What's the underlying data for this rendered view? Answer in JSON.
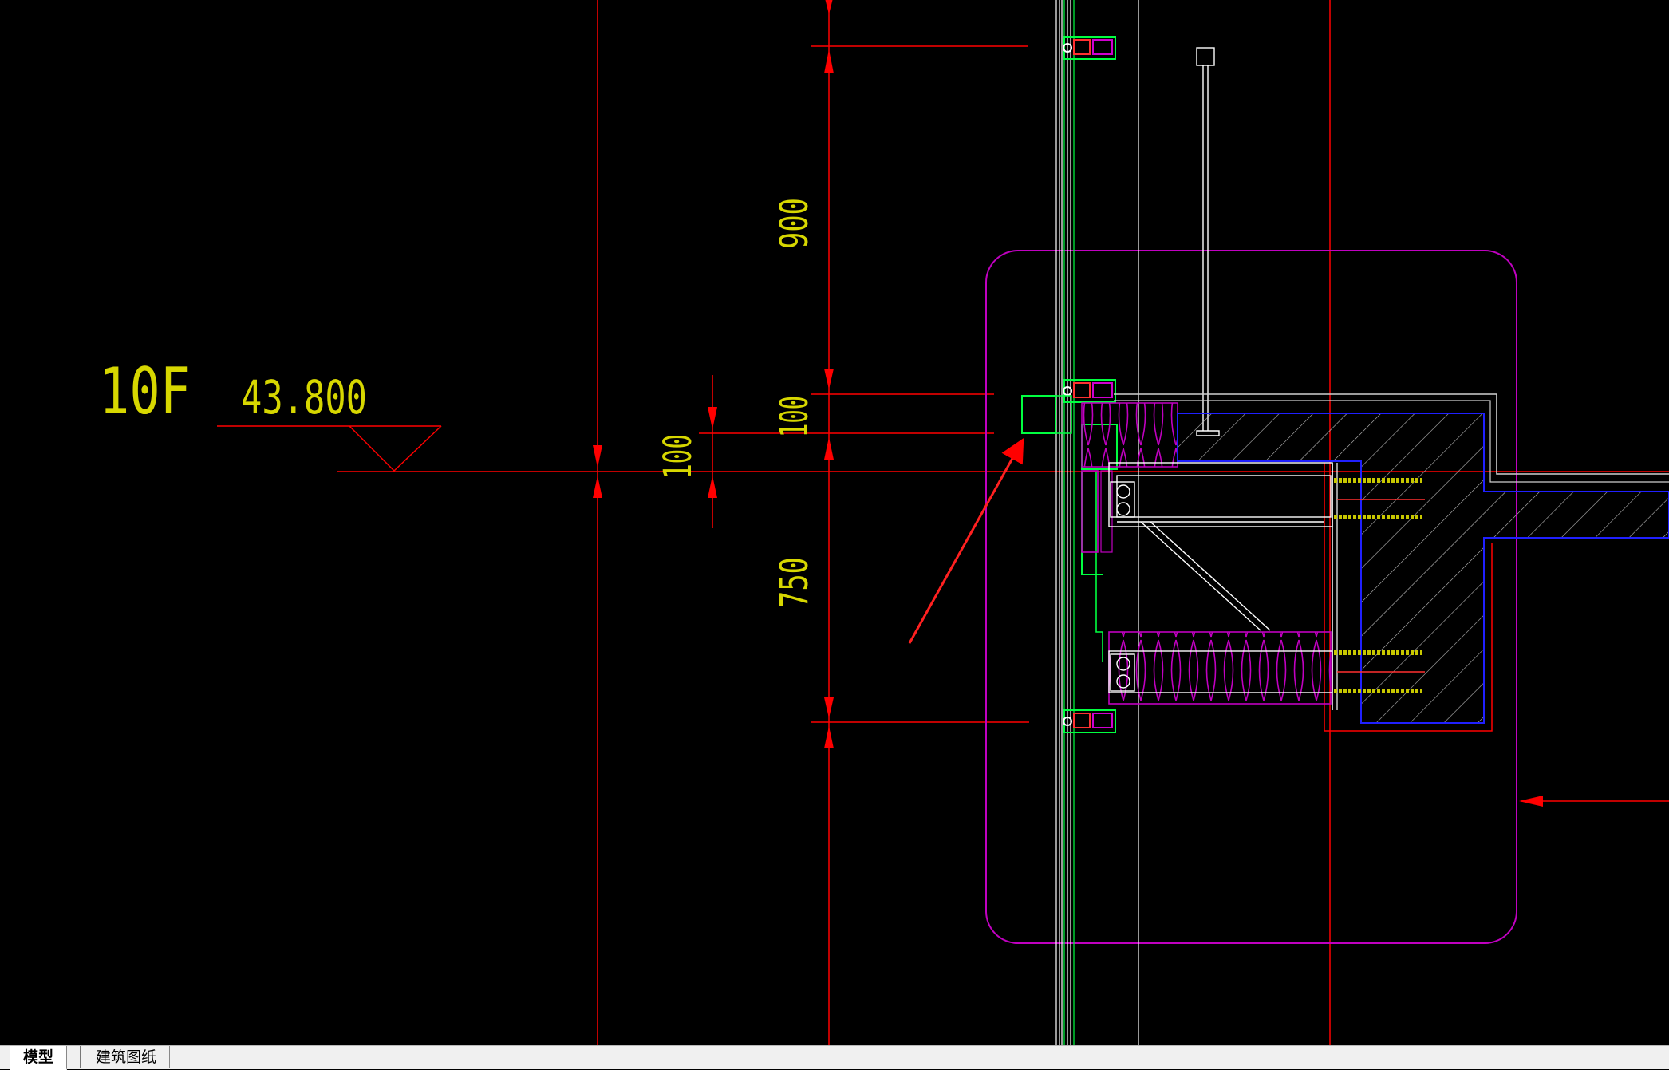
{
  "drawing": {
    "level_label": "10F",
    "elevation": "43.800",
    "dimensions": {
      "dim_900": "900",
      "dim_100_upper": "100",
      "dim_100_left": "100",
      "dim_750": "750"
    },
    "colors": {
      "background": "#000000",
      "dimension_line": "#ff0000",
      "dimension_text": "#d7d700",
      "callout_frame": "#c000c0",
      "mullion": "#00ff40",
      "glass": "#ffffff",
      "concrete_edge": "#2020ff",
      "hatch": "#c8c8c8",
      "insulation": "#c000c0",
      "anchor_bolt": "#c8c800",
      "leader_arrow": "#ff2020"
    }
  },
  "layout_tabs": {
    "model": "模型",
    "sheet": "建筑图纸"
  }
}
